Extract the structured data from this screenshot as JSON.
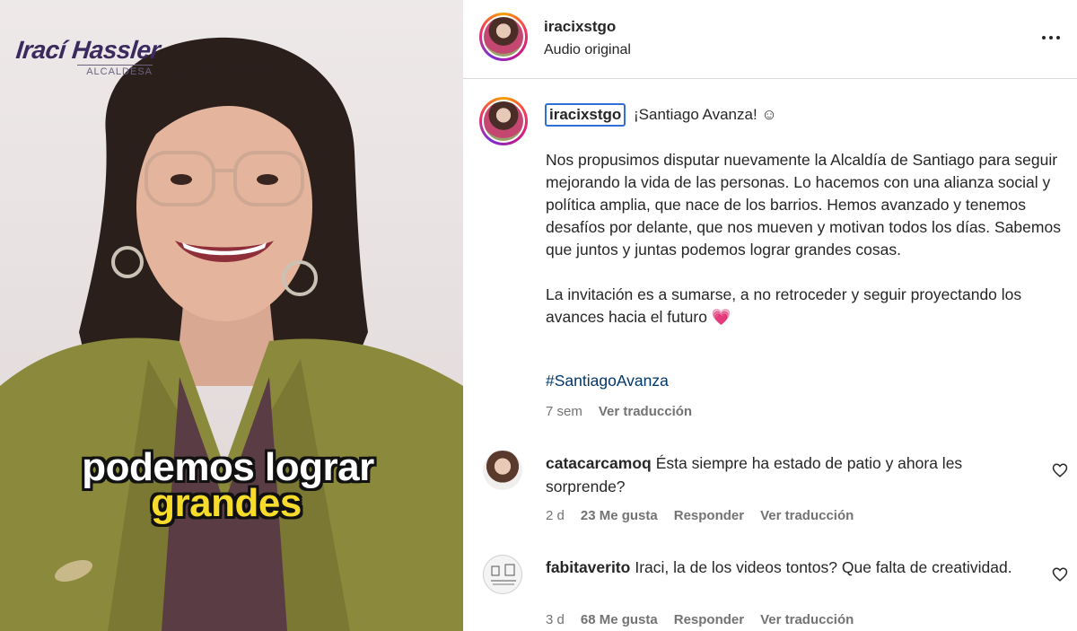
{
  "video": {
    "brand_name": "Irací Hassler",
    "brand_sub": "ALCALDESA",
    "caption_line1": "podemos lograr",
    "caption_line2": "grandes"
  },
  "header": {
    "username": "iracixstgo",
    "audio_label": "Audio original"
  },
  "caption": {
    "username": "iracixstgo",
    "first_line": "¡Santiago Avanza! ☺",
    "paragraph1": "Nos propusimos disputar nuevamente la Alcaldía de Santiago para seguir mejorando la vida de las personas. Lo hacemos con una alianza social y política amplia, que nace de los barrios. Hemos avanzado y tenemos desafíos por delante, que nos mueven y motivan todos los días. Sabemos que juntos y juntas podemos lograr grandes cosas.",
    "paragraph2": "La invitación es a sumarse, a no retroceder y seguir proyectando los avances hacia el futuro 💗",
    "hashtag": "#SantiagoAvanza",
    "age": "7 sem",
    "translate_label": "Ver traducción"
  },
  "comments": [
    {
      "username": "catacarcamoq",
      "text": "Ésta siempre ha estado de patio y ahora les sorprende?",
      "age": "2 d",
      "likes": "23 Me gusta",
      "reply_label": "Responder",
      "translate_label": "Ver traducción",
      "avatar_icon": "user-photo-icon"
    },
    {
      "username": "fabitaverito",
      "text": "Iraci, la de los videos tontos? Que falta de creatividad.",
      "age": "3 d",
      "likes": "68 Me gusta",
      "reply_label": "Responder",
      "translate_label": "Ver traducción",
      "avatar_icon": "illustration-avatar-icon"
    }
  ],
  "icons": {
    "more": "more-horizontal-icon",
    "like": "heart-outline-icon"
  },
  "colors": {
    "link_blue": "#00376b",
    "focus_outline": "#2f6fd6",
    "caption_yellow": "#f7dc2b",
    "muted_text": "#737373"
  }
}
